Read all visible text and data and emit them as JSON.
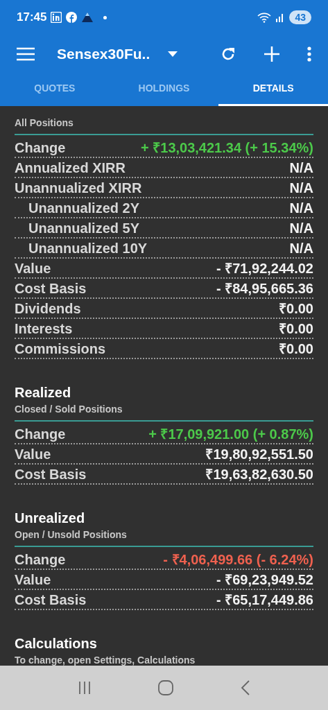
{
  "status_bar": {
    "time": "17:45",
    "battery": "43"
  },
  "toolbar": {
    "title": "Sensex30Fu.."
  },
  "tabs": [
    {
      "label": "QUOTES",
      "selected": false
    },
    {
      "label": "HOLDINGS",
      "selected": false
    },
    {
      "label": "DETAILS",
      "selected": true
    }
  ],
  "sections": [
    {
      "subtitle": "All Positions",
      "rows": [
        {
          "label": "Change",
          "value": "+ ₹13,03,421.34 (+ 15.34%)",
          "color": "#4cc94a",
          "indented": false
        },
        {
          "label": "Annualized XIRR",
          "value": "N/A",
          "color": "#f2f2f2",
          "indented": false
        },
        {
          "label": "Unannualized XIRR",
          "value": "N/A",
          "color": "#f2f2f2",
          "indented": false
        },
        {
          "label": "Unannualized 2Y",
          "value": "N/A",
          "color": "#f2f2f2",
          "indented": true
        },
        {
          "label": "Unannualized 5Y",
          "value": "N/A",
          "color": "#f2f2f2",
          "indented": true
        },
        {
          "label": "Unannualized 10Y",
          "value": "N/A",
          "color": "#f2f2f2",
          "indented": true
        },
        {
          "label": "Value",
          "value": "- ₹71,92,244.02",
          "color": "#f2f2f2",
          "indented": false
        },
        {
          "label": "Cost Basis",
          "value": "- ₹84,95,665.36",
          "color": "#f2f2f2",
          "indented": false
        },
        {
          "label": "Dividends",
          "value": "₹0.00",
          "color": "#f2f2f2",
          "indented": false
        },
        {
          "label": "Interests",
          "value": "₹0.00",
          "color": "#f2f2f2",
          "indented": false
        },
        {
          "label": "Commissions",
          "value": "₹0.00",
          "color": "#f2f2f2",
          "indented": false
        }
      ]
    },
    {
      "title": "Realized",
      "subtitle": "Closed / Sold Positions",
      "rows": [
        {
          "label": "Change",
          "value": "+ ₹17,09,921.00 (+ 0.87%)",
          "color": "#4cc94a",
          "indented": false
        },
        {
          "label": "Value",
          "value": "₹19,80,92,551.50",
          "color": "#f2f2f2",
          "indented": false
        },
        {
          "label": "Cost Basis",
          "value": "₹19,63,82,630.50",
          "color": "#f2f2f2",
          "indented": false
        }
      ]
    },
    {
      "title": "Unrealized",
      "subtitle": "Open / Unsold Positions",
      "rows": [
        {
          "label": "Change",
          "value": "- ₹4,06,499.66 (- 6.24%)",
          "color": "#f0614f",
          "indented": false
        },
        {
          "label": "Value",
          "value": "- ₹69,23,949.52",
          "color": "#f2f2f2",
          "indented": false
        },
        {
          "label": "Cost Basis",
          "value": "- ₹65,17,449.86",
          "color": "#f2f2f2",
          "indented": false
        }
      ]
    },
    {
      "title": "Calculations",
      "subtitle": "To change, open Settings, Calculations"
    }
  ]
}
